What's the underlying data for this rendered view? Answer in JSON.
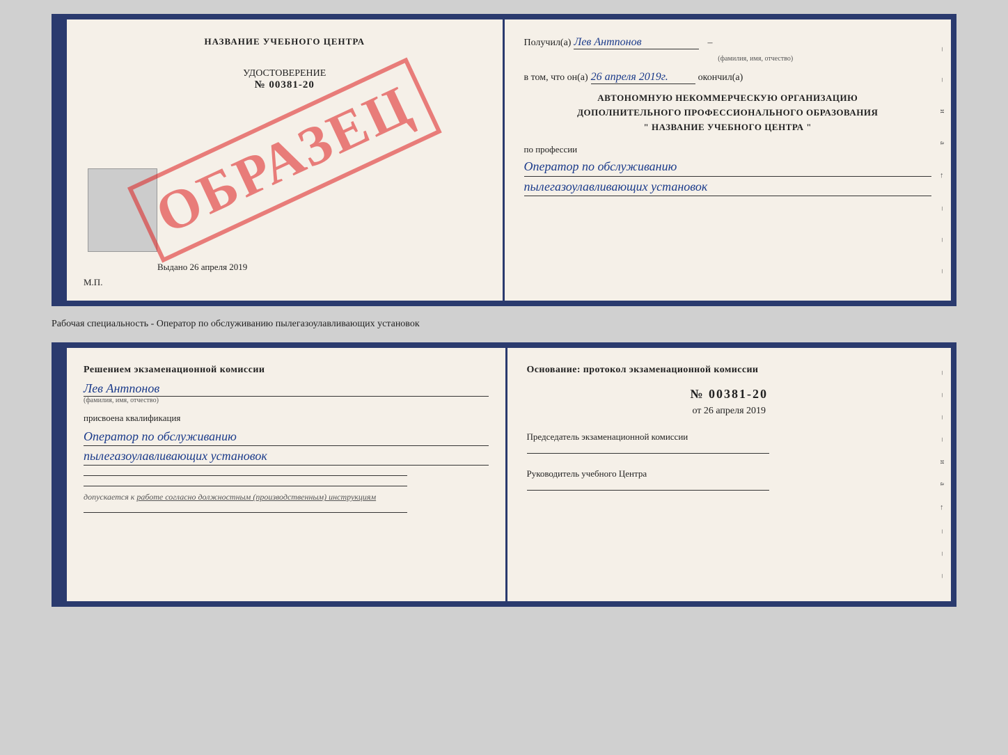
{
  "top_cert": {
    "left": {
      "title": "НАЗВАНИЕ УЧЕБНОГО ЦЕНТРА",
      "document_label": "УДОСТОВЕРЕНИЕ",
      "document_number": "№ 00381-20",
      "issued_label": "Выдано",
      "issued_date": "26 апреля 2019",
      "mp_label": "М.П.",
      "watermark": "ОБРАЗЕЦ"
    },
    "right": {
      "received_label": "Получил(а)",
      "received_name": "Лев Антпонов",
      "name_subtext": "(фамилия, имя, отчество)",
      "in_that_label": "в том, что он(а)",
      "completion_date": "26 апреля 2019г.",
      "finished_label": "окончил(а)",
      "org_line1": "АВТОНОМНУЮ НЕКОММЕРЧЕСКУЮ ОРГАНИЗАЦИЮ",
      "org_line2": "ДОПОЛНИТЕЛЬНОГО ПРОФЕССИОНАЛЬНОГО ОБРАЗОВАНИЯ",
      "org_line3": "\" НАЗВАНИЕ УЧЕБНОГО ЦЕНТРА \"",
      "profession_label": "по профессии",
      "profession_line1": "Оператор по обслуживанию",
      "profession_line2": "пылегазоулавливающих установок",
      "side_marks": [
        "–",
        "–",
        "–",
        "–",
        "и",
        "а",
        "←",
        "–",
        "–",
        "–"
      ]
    }
  },
  "middle_label": "Рабочая специальность - Оператор по обслуживанию пылегазоулавливающих установок",
  "bottom_cert": {
    "left": {
      "decision_text": "Решением экзаменационной комиссии",
      "person_name": "Лев Антпонов",
      "name_subtext": "(фамилия, имя, отчество)",
      "qualification_label": "присвоена квалификация",
      "qualification_line1": "Оператор по обслуживанию",
      "qualification_line2": "пылегазоулавливающих установок",
      "allowed_text": "допускается к работе согласно должностным (производственным) инструкциям"
    },
    "right": {
      "basis_label": "Основание: протокол экзаменационной комиссии",
      "protocol_number": "№ 00381-20",
      "protocol_date_prefix": "от",
      "protocol_date": "26 апреля 2019",
      "chairman_label": "Председатель экзаменационной комиссии",
      "director_label": "Руководитель учебного Центра",
      "side_marks": [
        "–",
        "–",
        "–",
        "–",
        "и",
        "а",
        "←",
        "–",
        "–",
        "–"
      ]
    }
  }
}
